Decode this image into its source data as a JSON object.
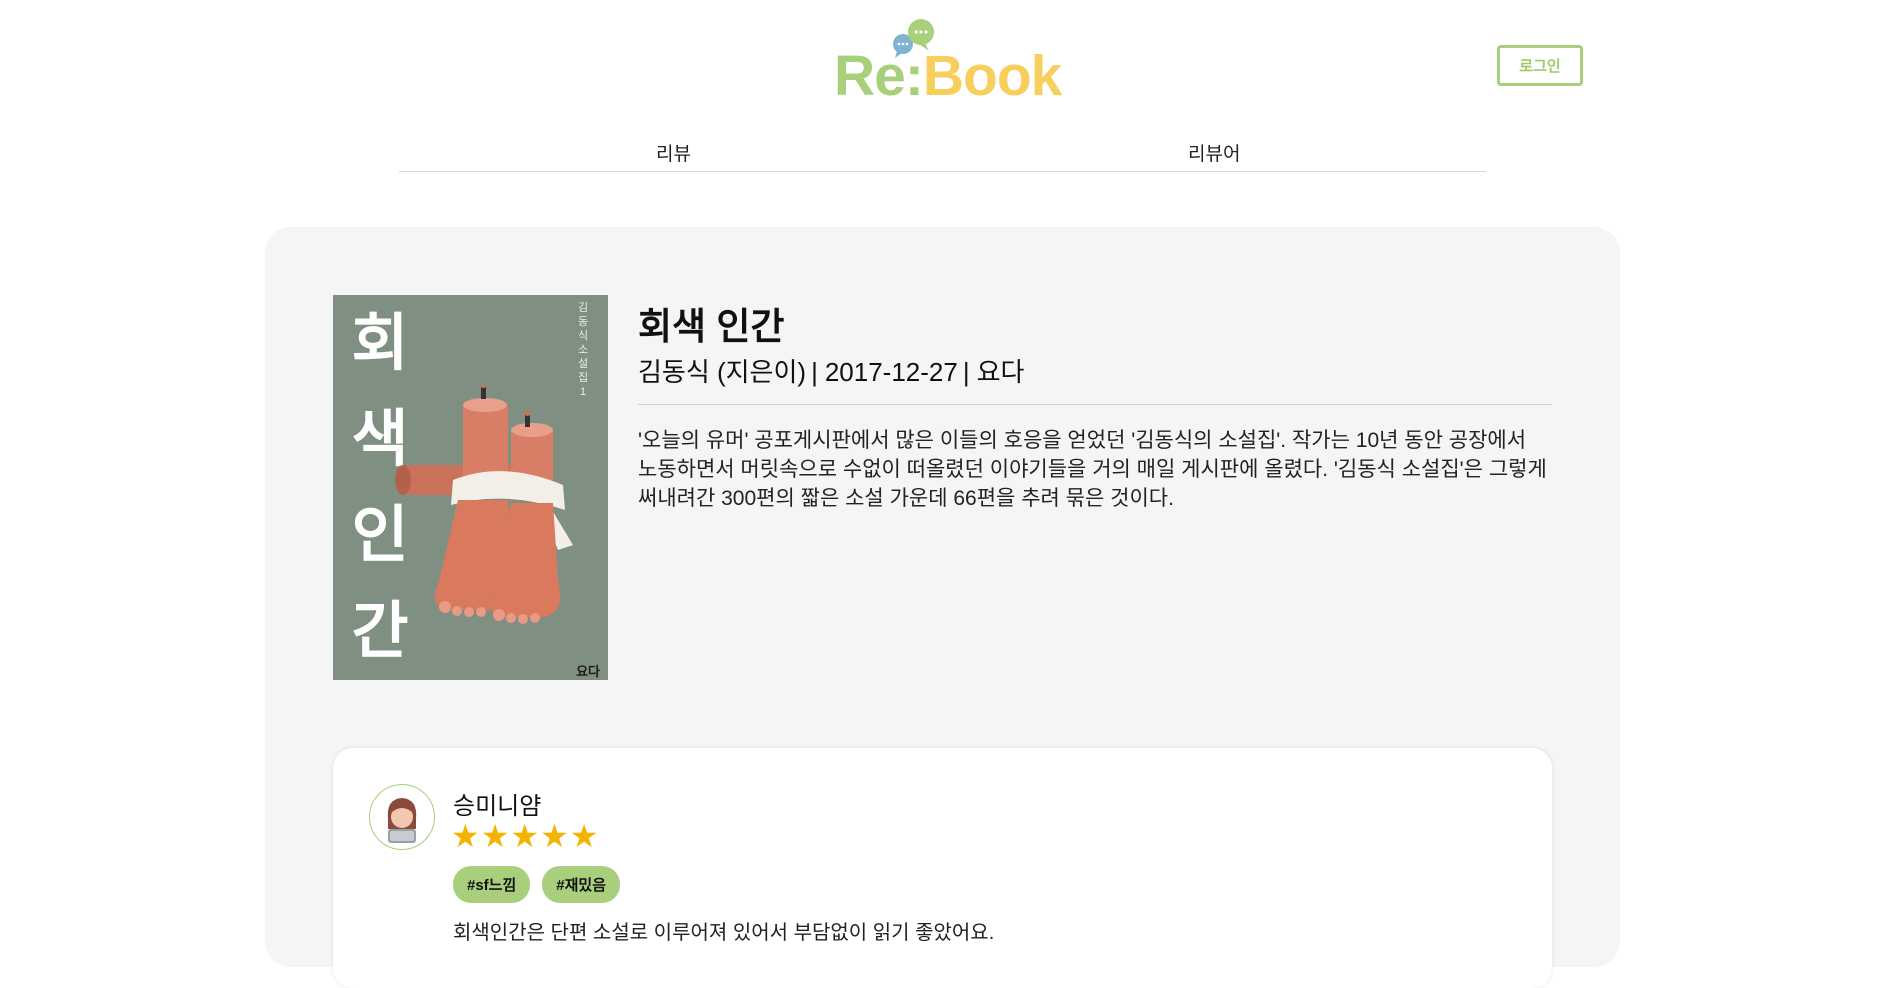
{
  "header": {
    "logo_re": "Re",
    "logo_colon": ":",
    "logo_book": "Book",
    "login_label": "로그인",
    "nav": [
      {
        "label": "리뷰"
      },
      {
        "label": "리뷰어"
      }
    ]
  },
  "book": {
    "title": "회색 인간",
    "author": "김동식 (지은이)",
    "date": "2017-12-27",
    "publisher": "요다",
    "separator": "|",
    "description": "'오늘의 유머' 공포게시판에서 많은 이들의 호응을 얻었던 '김동식의 소설집'. 작가는 10년 동안 공장에서 노동하면서 머릿속으로 수없이 떠올렸던 이야기들을 거의 매일 게시판에 올렸다. '김동식 소설집'은 그렇게 써내려간 300편의 짧은 소설 가운데 66편을 추려 묶은 것이다.",
    "cover": {
      "title_chars": [
        "회",
        "색",
        "인",
        "간"
      ],
      "side_text": "김동식 소설집 1",
      "publisher_mark": "요다",
      "background": "#7f8f82"
    }
  },
  "review": {
    "reviewer": "승미니얌",
    "rating": 5,
    "stars": "★★★★★",
    "tags": [
      "#sf느낌",
      "#재밌음"
    ],
    "text": "회색인간은 단편 소설로 이루어져 있어서 부담없이 읽기 좋았어요."
  },
  "colors": {
    "accent_green": "#a8cf7a",
    "accent_yellow": "#f7cf5c",
    "star": "#f5b301",
    "panel_bg": "#f4f5f4"
  }
}
